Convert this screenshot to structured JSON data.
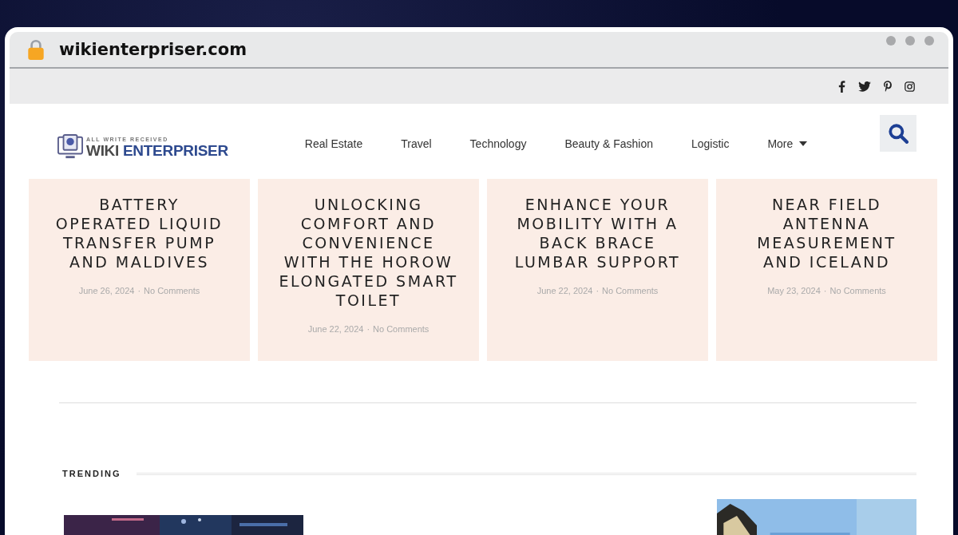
{
  "browser": {
    "url": "wikienterpriser.com"
  },
  "header": {
    "logo": {
      "tagline": "ALL WRITE RECEIVED",
      "name_dark": "WIKI",
      "name_blue": "ENTERPRISER"
    },
    "nav": [
      {
        "label": "Real Estate",
        "dropdown": false
      },
      {
        "label": "Travel",
        "dropdown": false
      },
      {
        "label": "Technology",
        "dropdown": false
      },
      {
        "label": "Beauty & Fashion",
        "dropdown": false
      },
      {
        "label": "Logistic",
        "dropdown": false
      },
      {
        "label": "More",
        "dropdown": true
      }
    ]
  },
  "posts": [
    {
      "title": "BATTERY OPERATED LIQUID TRANSFER PUMP AND MALDIVES",
      "date": "June 26, 2024",
      "sep": "·",
      "comments": "No Comments"
    },
    {
      "title": "UNLOCKING COMFORT AND CONVENIENCE WITH THE HOROW ELONGATED SMART TOILET",
      "date": "June 22, 2024",
      "sep": "·",
      "comments": "No Comments"
    },
    {
      "title": "ENHANCE YOUR MOBILITY WITH A BACK BRACE LUMBAR SUPPORT",
      "date": "June 22, 2024",
      "sep": "·",
      "comments": "No Comments"
    },
    {
      "title": "NEAR FIELD ANTENNA MEASUREMENT AND ICELAND",
      "date": "May 23, 2024",
      "sep": "·",
      "comments": "No Comments"
    }
  ],
  "trending": {
    "heading": "TRENDING",
    "items": [
      {
        "kind": "picture"
      },
      {
        "kind": "empty"
      },
      {
        "kind": "picture"
      }
    ]
  }
}
